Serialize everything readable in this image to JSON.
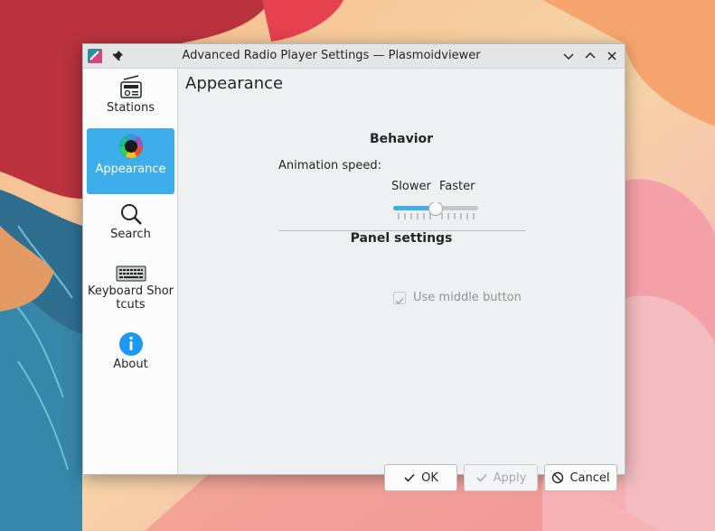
{
  "window": {
    "title": "Advanced Radio Player Settings — Plasmoidviewer"
  },
  "sidebar": {
    "items": [
      {
        "label": "Stations",
        "icon": "radio-icon",
        "active": false
      },
      {
        "label": "Appearance",
        "icon": "color-wheel-icon",
        "active": true
      },
      {
        "label": "Search",
        "icon": "search-icon",
        "active": false
      },
      {
        "label": "Keyboard Shortcuts",
        "icon": "keyboard-icon",
        "active": false
      },
      {
        "label": "About",
        "icon": "info-icon",
        "active": false
      }
    ]
  },
  "page": {
    "title": "Appearance",
    "behavior": {
      "heading": "Behavior",
      "animation_label": "Animation speed:",
      "slider_value": 0.5,
      "slider_min_label": "Slower",
      "slider_max_label": "Faster"
    },
    "panel": {
      "heading": "Panel settings",
      "middle_button_label": "Use middle button",
      "middle_button_checked": true,
      "middle_button_enabled": false
    }
  },
  "buttons": {
    "ok": "OK",
    "apply": "Apply",
    "cancel": "Cancel"
  },
  "colors": {
    "accent": "#3daee9",
    "window_bg": "#eff0f1"
  }
}
